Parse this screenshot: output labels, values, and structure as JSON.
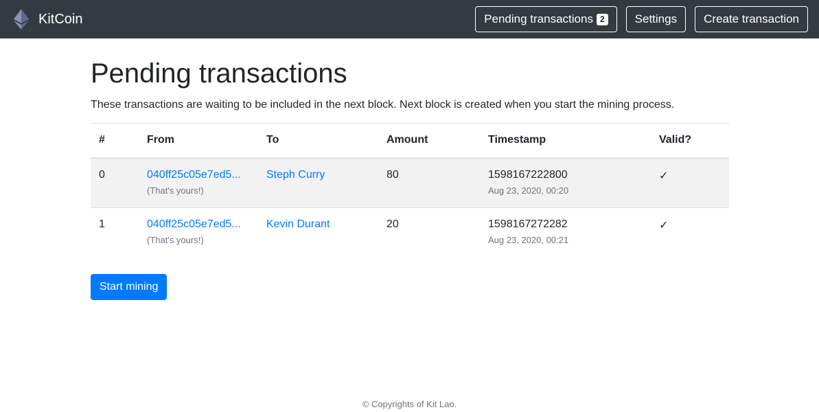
{
  "app": {
    "name": "KitCoin",
    "logo_icon": "ethereum-diamond-icon"
  },
  "nav": {
    "pending_label": "Pending transactions",
    "pending_count": "2",
    "settings_label": "Settings",
    "create_label": "Create transaction"
  },
  "page": {
    "title": "Pending transactions",
    "description": "These transactions are waiting to be included in the next block. Next block is created when you start the mining process."
  },
  "table": {
    "headers": [
      "#",
      "From",
      "To",
      "Amount",
      "Timestamp",
      "Valid?"
    ],
    "rows": [
      {
        "index": "0",
        "from": "040ff25c05e7ed5...",
        "from_note": "(That's yours!)",
        "to": "Steph Curry",
        "amount": "80",
        "timestamp": "1598167222800",
        "date": "Aug 23, 2020, 00:20",
        "valid": "✓"
      },
      {
        "index": "1",
        "from": "040ff25c05e7ed5...",
        "from_note": "(That's yours!)",
        "to": "Kevin Durant",
        "amount": "20",
        "timestamp": "1598167272282",
        "date": "Aug 23, 2020, 00:21",
        "valid": "✓"
      }
    ]
  },
  "actions": {
    "start_mining_label": "Start mining"
  },
  "footer": {
    "text": "© Copyrights of Kit Lao."
  },
  "colors": {
    "navbar": "#343a40",
    "primary": "#007bff",
    "striped_row": "#f2f2f2",
    "muted": "#6c757d"
  }
}
